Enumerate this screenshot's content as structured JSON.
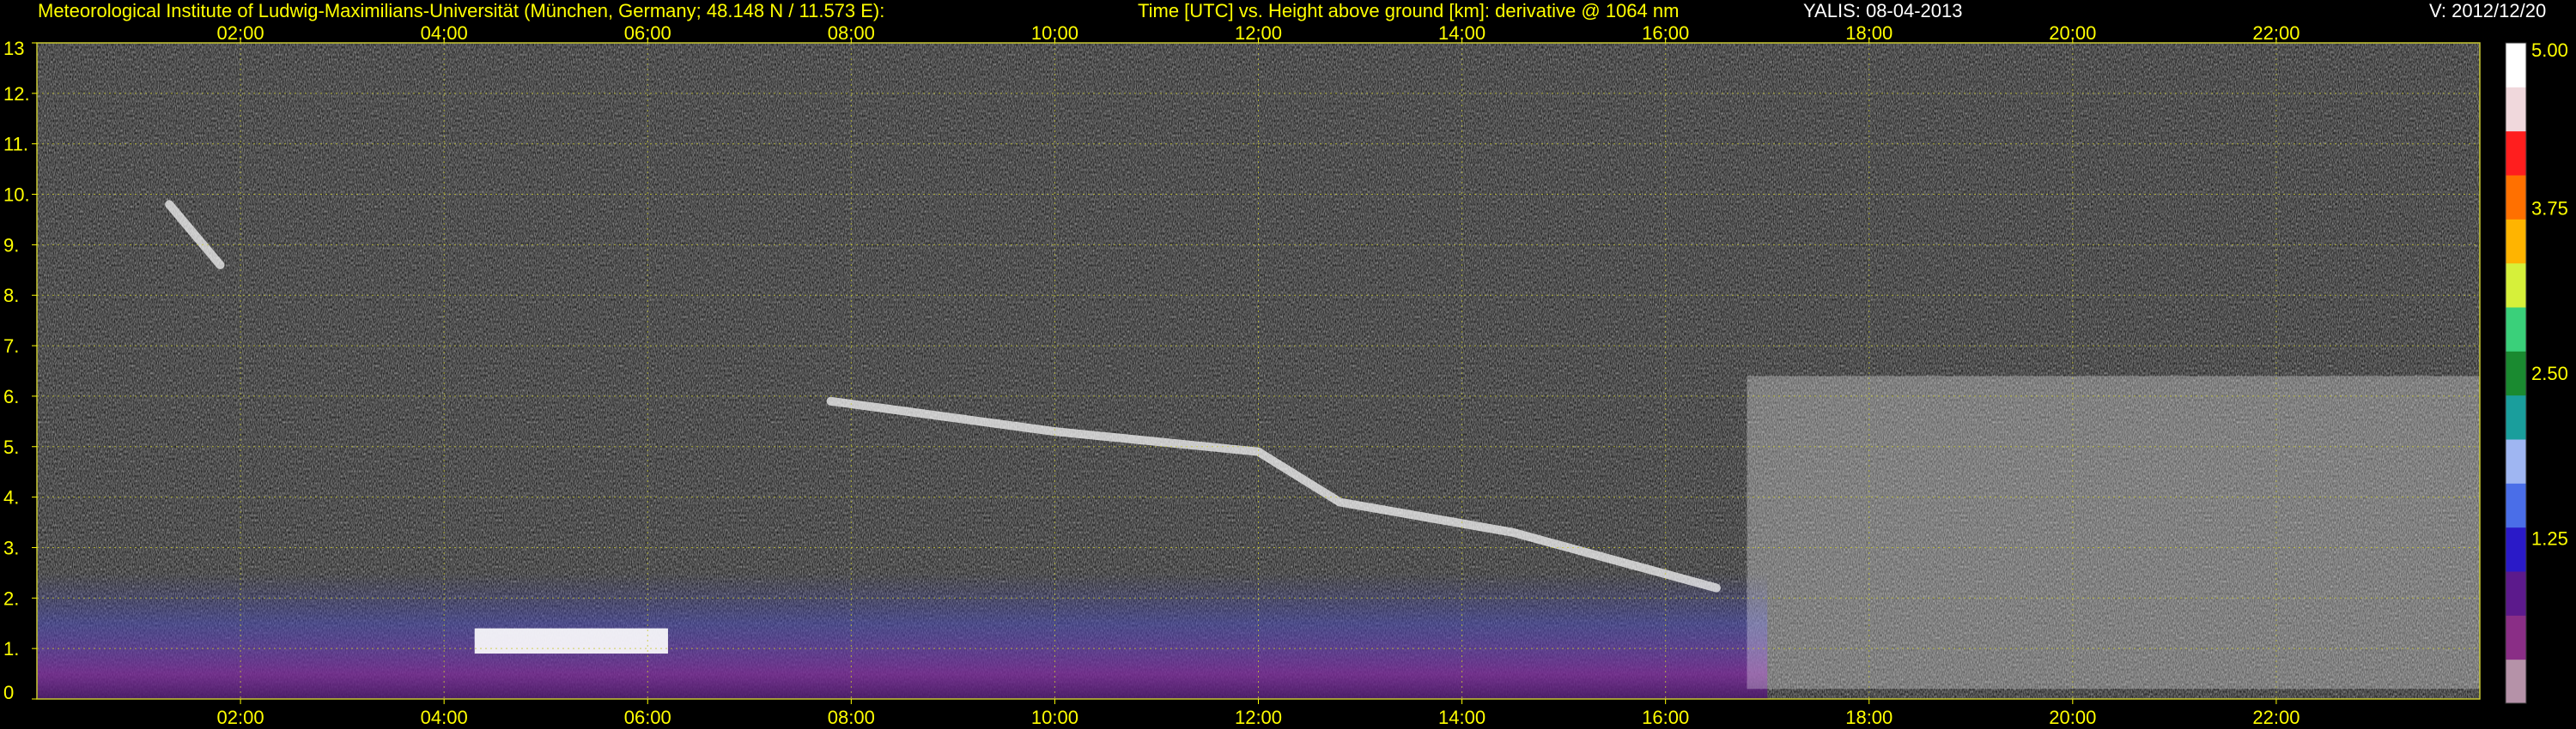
{
  "header": {
    "institute": "Meteorological Institute of Ludwig-Maximilians-Universität (München, Germany; 48.148 N / 11.573 E):",
    "title": "Time [UTC] vs. Height above ground [km]: derivative @ 1064 nm",
    "instrument_date": "YALIS: 08-04-2013",
    "version": "V: 2012/12/20"
  },
  "colors": {
    "text": "#ffff00",
    "grid": "#c8c832",
    "background": "#000000",
    "noise": "#8a8a8a"
  },
  "chart_data": {
    "type": "heatmap",
    "title": "Time [UTC] vs. Height above ground [km]: derivative @ 1064 nm",
    "xlabel": "Time [UTC]",
    "ylabel": "Height above ground [km]",
    "xlim": [
      0.0,
      24.0
    ],
    "ylim": [
      0,
      13
    ],
    "x_ticks": [
      2,
      4,
      6,
      8,
      10,
      12,
      14,
      16,
      18,
      20,
      22
    ],
    "x_tick_labels": [
      "02:00",
      "04:00",
      "06:00",
      "08:00",
      "10:00",
      "12:00",
      "14:00",
      "16:00",
      "18:00",
      "20:00",
      "22:00"
    ],
    "y_ticks": [
      0,
      1,
      2,
      3,
      4,
      5,
      6,
      7,
      8,
      9,
      10,
      11,
      12,
      13
    ],
    "y_tick_labels": [
      "0",
      "1.",
      "2.",
      "3.",
      "4.",
      "5.",
      "6.",
      "7.",
      "8.",
      "9.",
      "10.",
      "11.",
      "12.",
      "13"
    ],
    "grid": true,
    "colorbar": {
      "min": 0,
      "max": 5.0,
      "tick_values": [
        1.25,
        2.5,
        3.75,
        5.0
      ],
      "tick_labels": [
        "1.25",
        "2.50",
        "3.75",
        "5.00"
      ],
      "colors": [
        "#b592a8",
        "#8a2e86",
        "#5c1a8c",
        "#2a1ac8",
        "#4a6ee8",
        "#9fb6f2",
        "#1a9e9c",
        "#1a8a30",
        "#3ad07a",
        "#d6f03a",
        "#ffb400",
        "#ff7000",
        "#ff1e1e",
        "#f0d8dc",
        "#ffffff"
      ]
    },
    "features": [
      {
        "description": "dense aerosol boundary layer (blue/purple)",
        "time_start": 0.0,
        "time_end": 17.0,
        "height_bottom": 0.0,
        "height_top": 2.5
      },
      {
        "description": "bright low layer",
        "time_start": 4.3,
        "time_end": 6.2,
        "height_bottom": 0.9,
        "height_top": 1.4
      },
      {
        "description": "descending elevated layer",
        "points": [
          [
            7.8,
            5.9
          ],
          [
            10.0,
            5.3
          ],
          [
            12.0,
            4.9
          ],
          [
            12.8,
            3.9
          ],
          [
            14.5,
            3.3
          ],
          [
            16.5,
            2.2
          ]
        ]
      },
      {
        "description": "cloud / convective returns",
        "time_start": 16.8,
        "time_end": 24.0,
        "height_bottom": 0.2,
        "height_top": 6.4
      },
      {
        "description": "high cirrus streak",
        "points": [
          [
            1.3,
            9.8
          ],
          [
            1.8,
            8.6
          ]
        ]
      }
    ]
  }
}
